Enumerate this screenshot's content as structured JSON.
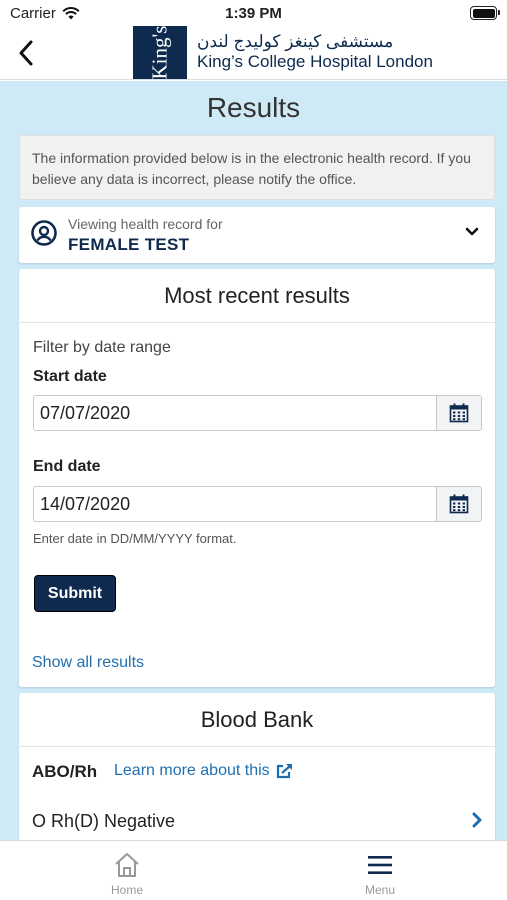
{
  "status_bar": {
    "carrier": "Carrier",
    "time": "1:39 PM"
  },
  "header": {
    "logo_mark_text": "King's",
    "logo_arabic": "مستشفى كينغز كوليدج لندن",
    "logo_english": "King’s College Hospital London"
  },
  "page": {
    "title": "Results"
  },
  "notice": {
    "text": "The information provided below is in the electronic health record. If you believe any data is incorrect, please notify the office."
  },
  "record": {
    "label": "Viewing health record for",
    "name": "FEMALE TEST"
  },
  "results": {
    "title": "Most recent results",
    "filter_label": "Filter by date range",
    "start_label": "Start date",
    "start_value": "07/07/2020",
    "end_label": "End date",
    "end_value": "14/07/2020",
    "hint": "Enter date in DD/MM/YYYY format.",
    "submit_label": "Submit",
    "show_all_label": "Show all results"
  },
  "blood_bank": {
    "title": "Blood Bank",
    "test_label": "ABO/Rh",
    "learn_more_label": "Learn more about this",
    "value": "O Rh(D) Negative"
  },
  "tabbar": {
    "home_label": "Home",
    "menu_label": "Menu"
  },
  "colors": {
    "brand_navy": "#0e2a4e",
    "link_blue": "#1f6fb0",
    "content_background": "#cfeaf7"
  }
}
